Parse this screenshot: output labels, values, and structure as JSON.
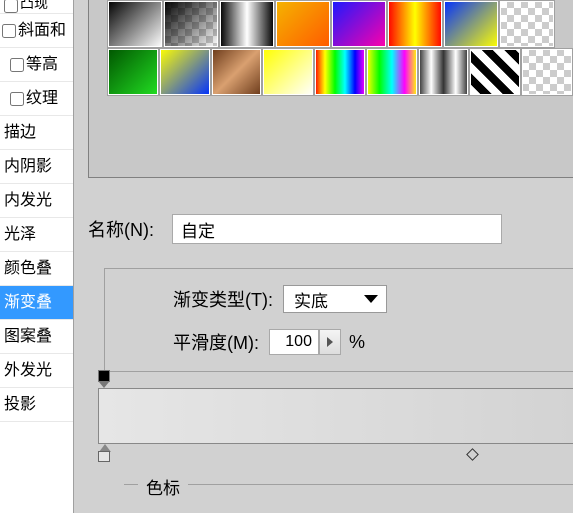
{
  "sidebar": {
    "frag_top": "凸现",
    "items": [
      {
        "label": "斜面和",
        "check": true,
        "checked": false
      },
      {
        "label": "等高",
        "check": true,
        "checked": false,
        "indent": true
      },
      {
        "label": "纹理",
        "check": true,
        "checked": false,
        "indent": true
      },
      {
        "label": "描边",
        "check": false
      },
      {
        "label": "内阴影",
        "check": false
      },
      {
        "label": "内发光",
        "check": false
      },
      {
        "label": "光泽",
        "check": false
      },
      {
        "label": "颜色叠",
        "check": false
      },
      {
        "label": "渐变叠",
        "check": false,
        "selected": true
      },
      {
        "label": "图案叠",
        "check": false
      },
      {
        "label": "外发光",
        "check": false
      },
      {
        "label": "投影",
        "check": false
      }
    ]
  },
  "name_row": {
    "label": "名称(N):",
    "value": "自定"
  },
  "editor": {
    "type_label": "渐变类型(T):",
    "type_value": "实底",
    "smooth_label": "平滑度(M):",
    "smooth_value": "100",
    "pct": "%"
  },
  "stops_legend": "色标"
}
